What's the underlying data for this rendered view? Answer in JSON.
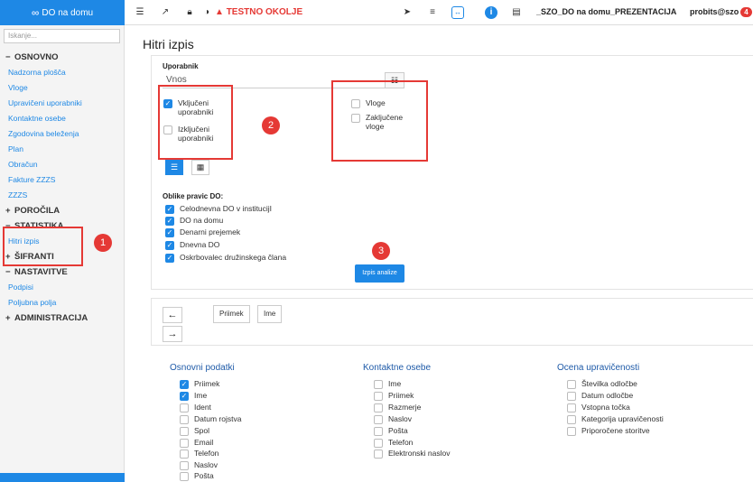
{
  "topbar": {
    "brand": "DO na domu",
    "testno": "TESTNO OKOLJE",
    "project": "_SZO_DO na domu_PREZENTACIJA",
    "user": "probits@szo",
    "user_badge": "4"
  },
  "sidebar": {
    "search_placeholder": "Iskanje...",
    "osnovno": "OSNOVNO",
    "osnovno_items": [
      "Nadzorna plošča",
      "Vloge",
      "Upravičeni uporabniki",
      "Kontaktne osebe",
      "Zgodovina beleženja",
      "Plan",
      "Obračun",
      "Fakture ZZZS",
      "ZZZS"
    ],
    "porocila": "POROČILA",
    "statistika": "STATISTIKA",
    "hitri_izpis": "Hitri izpis",
    "sifranti": "ŠIFRANTI",
    "nastavitve": "NASTAVITVE",
    "nastavitve_items": [
      "Podpisi",
      "Poljubna polja"
    ],
    "administracija": "ADMINISTRACIJA"
  },
  "main": {
    "title": "Hitri izpis",
    "uporabnik_label": "Uporabnik",
    "vnos": "Vnos",
    "vkljuceni": "Vključeni uporabniki",
    "izkljuceni": "Izključeni uporabniki",
    "vloge": "Vloge",
    "zakljucene": "Zaključene vloge",
    "oblike_label": "Oblike pravic DO:",
    "oblike": [
      "Celodnevna DO v institucijI",
      "DO na domu",
      "Denarni prejemek",
      "Dnevna DO",
      "Oskrbovalec družinskega člana"
    ],
    "izpis_btn": "Izpis analize",
    "badges": [
      "1",
      "2",
      "3"
    ]
  },
  "sort": {
    "tags": [
      "Priimek",
      "Ime"
    ]
  },
  "columns": {
    "osnovni_title": "Osnovni podatki",
    "osnovni": [
      "Priimek",
      "Ime",
      "Ident",
      "Datum rojstva",
      "Spol",
      "Email",
      "Telefon",
      "Naslov",
      "Pošta"
    ],
    "kontaktne_title": "Kontaktne osebe",
    "kontaktne": [
      "Ime",
      "Priimek",
      "Razmerje",
      "Naslov",
      "Pošta",
      "Telefon",
      "Elektronski naslov"
    ],
    "ocena_title": "Ocena upravičenosti",
    "ocena": [
      "Številka odločbe",
      "Datum odločbe",
      "Vstopna točka",
      "Kategorija upravičenosti",
      "Priporočene storitve"
    ]
  }
}
